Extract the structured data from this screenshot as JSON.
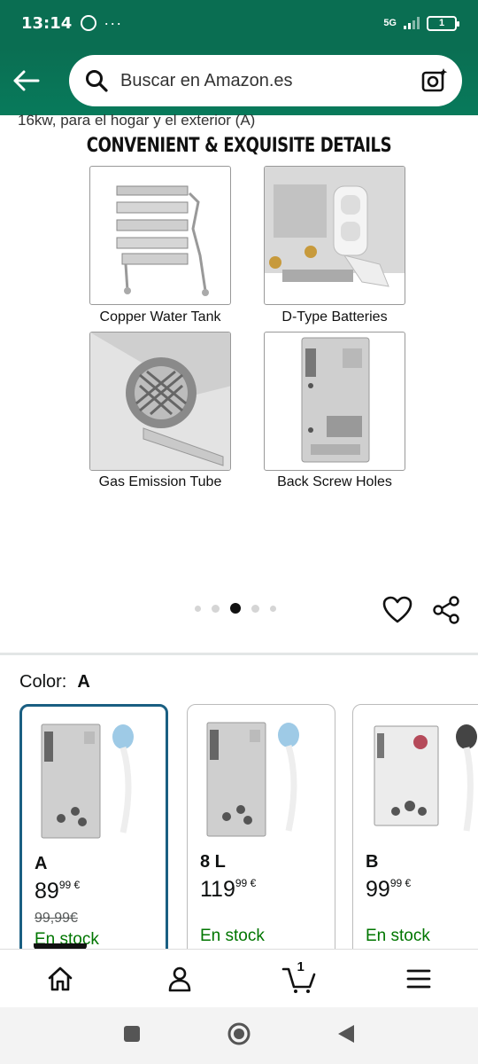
{
  "status_bar": {
    "time": "13:14",
    "dots": "···",
    "network": "5G",
    "battery": "1"
  },
  "search": {
    "placeholder": "Buscar en Amazon.es"
  },
  "product": {
    "title_fragment": "16kw, para el hogar y el exterior (A)"
  },
  "gallery": {
    "banner_title": "CONVENIENT & EXQUISITE DETAILS",
    "details": [
      {
        "caption": "Copper Water Tank"
      },
      {
        "caption": "D-Type Batteries"
      },
      {
        "caption": "Gas Emission Tube"
      },
      {
        "caption": "Back Screw Holes"
      }
    ],
    "page_count": 5,
    "active_page": 3
  },
  "color_selector": {
    "label": "Color:",
    "selected": "A",
    "options": [
      {
        "name": "A",
        "price_whole": "89",
        "price_fraction": "99",
        "currency": "€",
        "old_price": "99,99€",
        "stock": "En stock",
        "selected": true
      },
      {
        "name": "8 L",
        "price_whole": "119",
        "price_fraction": "99",
        "currency": "€",
        "old_price": "",
        "stock": "En stock",
        "selected": false
      },
      {
        "name": "B",
        "price_whole": "99",
        "price_fraction": "99",
        "currency": "€",
        "old_price": "",
        "stock": "En stock",
        "selected": false
      }
    ]
  },
  "bottom_nav": {
    "cart_count": "1",
    "items": [
      "home-icon",
      "account-icon",
      "cart-icon",
      "menu-icon"
    ]
  },
  "colors": {
    "header_green": "#0a6e52",
    "stock_green": "#007600",
    "selected_border": "#1a5f82"
  }
}
